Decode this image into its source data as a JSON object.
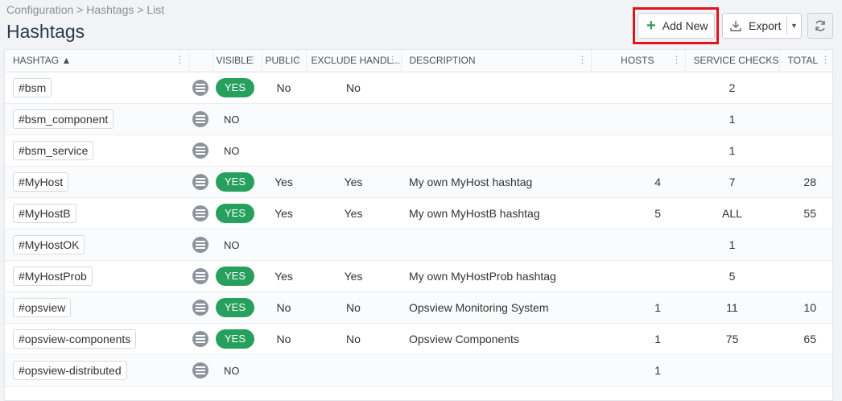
{
  "breadcrumb": "Configuration > Hashtags > List",
  "page_title": "Hashtags",
  "toolbar": {
    "add_new": "Add New",
    "export": "Export"
  },
  "colors": {
    "accent_green": "#27a05d",
    "highlight_red": "#e0141c"
  },
  "columns": [
    "HASHTAG",
    "VISIBLE",
    "PUBLIC",
    "EXCLUDE HANDL...",
    "DESCRIPTION",
    "HOSTS",
    "SERVICE CHECKS",
    "TOTAL"
  ],
  "sort_indicator": "▲",
  "rows": [
    {
      "tag": "#bsm",
      "visible": "YES",
      "public": "No",
      "exclude": "No",
      "description": "",
      "hosts": "",
      "service_checks": "2",
      "total": ""
    },
    {
      "tag": "#bsm_component",
      "visible": "NO",
      "public": "",
      "exclude": "",
      "description": "",
      "hosts": "",
      "service_checks": "1",
      "total": ""
    },
    {
      "tag": "#bsm_service",
      "visible": "NO",
      "public": "",
      "exclude": "",
      "description": "",
      "hosts": "",
      "service_checks": "1",
      "total": ""
    },
    {
      "tag": "#MyHost",
      "visible": "YES",
      "public": "Yes",
      "exclude": "Yes",
      "description": "My own MyHost hashtag",
      "hosts": "4",
      "service_checks": "7",
      "total": "28"
    },
    {
      "tag": "#MyHostB",
      "visible": "YES",
      "public": "Yes",
      "exclude": "Yes",
      "description": "My own MyHostB hashtag",
      "hosts": "5",
      "service_checks": "ALL",
      "total": "55"
    },
    {
      "tag": "#MyHostOK",
      "visible": "NO",
      "public": "",
      "exclude": "",
      "description": "",
      "hosts": "",
      "service_checks": "1",
      "total": ""
    },
    {
      "tag": "#MyHostProb",
      "visible": "YES",
      "public": "Yes",
      "exclude": "Yes",
      "description": "My own MyHostProb hashtag",
      "hosts": "",
      "service_checks": "5",
      "total": ""
    },
    {
      "tag": "#opsview",
      "visible": "YES",
      "public": "No",
      "exclude": "No",
      "description": "Opsview Monitoring System",
      "hosts": "1",
      "service_checks": "11",
      "total": "10"
    },
    {
      "tag": "#opsview-components",
      "visible": "YES",
      "public": "No",
      "exclude": "No",
      "description": "Opsview Components",
      "hosts": "1",
      "service_checks": "75",
      "total": "65"
    },
    {
      "tag": "#opsview-distributed",
      "visible": "NO",
      "public": "",
      "exclude": "",
      "description": "",
      "hosts": "1",
      "service_checks": "",
      "total": ""
    }
  ]
}
